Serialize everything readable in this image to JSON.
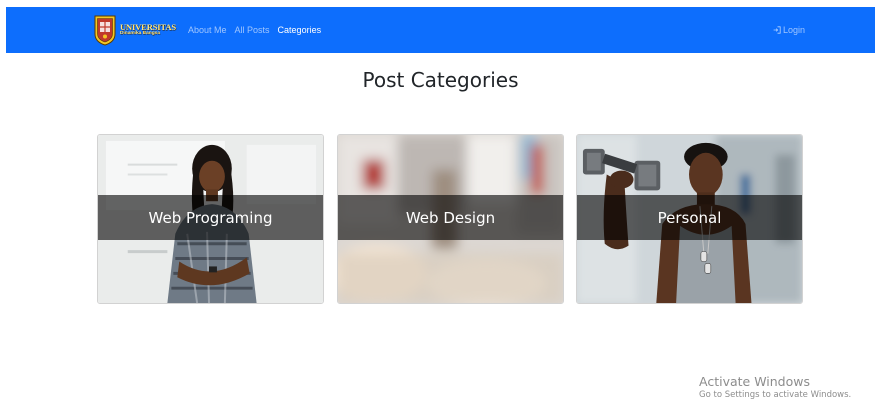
{
  "navbar": {
    "brand_title": "UNIVERSITAS",
    "brand_subtitle": "Dinamika Bangsa",
    "links": [
      {
        "label": "About Me",
        "active": false
      },
      {
        "label": "All Posts",
        "active": false
      },
      {
        "label": "Categories",
        "active": true
      }
    ],
    "login_label": "Login",
    "background_color": "#0d6efd"
  },
  "page": {
    "title": "Post Categories"
  },
  "categories": [
    {
      "title": "Web Programing"
    },
    {
      "title": "Web Design"
    },
    {
      "title": "Personal"
    }
  ],
  "watermark": {
    "line1": "Activate Windows",
    "line2": "Go to Settings to activate Windows."
  }
}
